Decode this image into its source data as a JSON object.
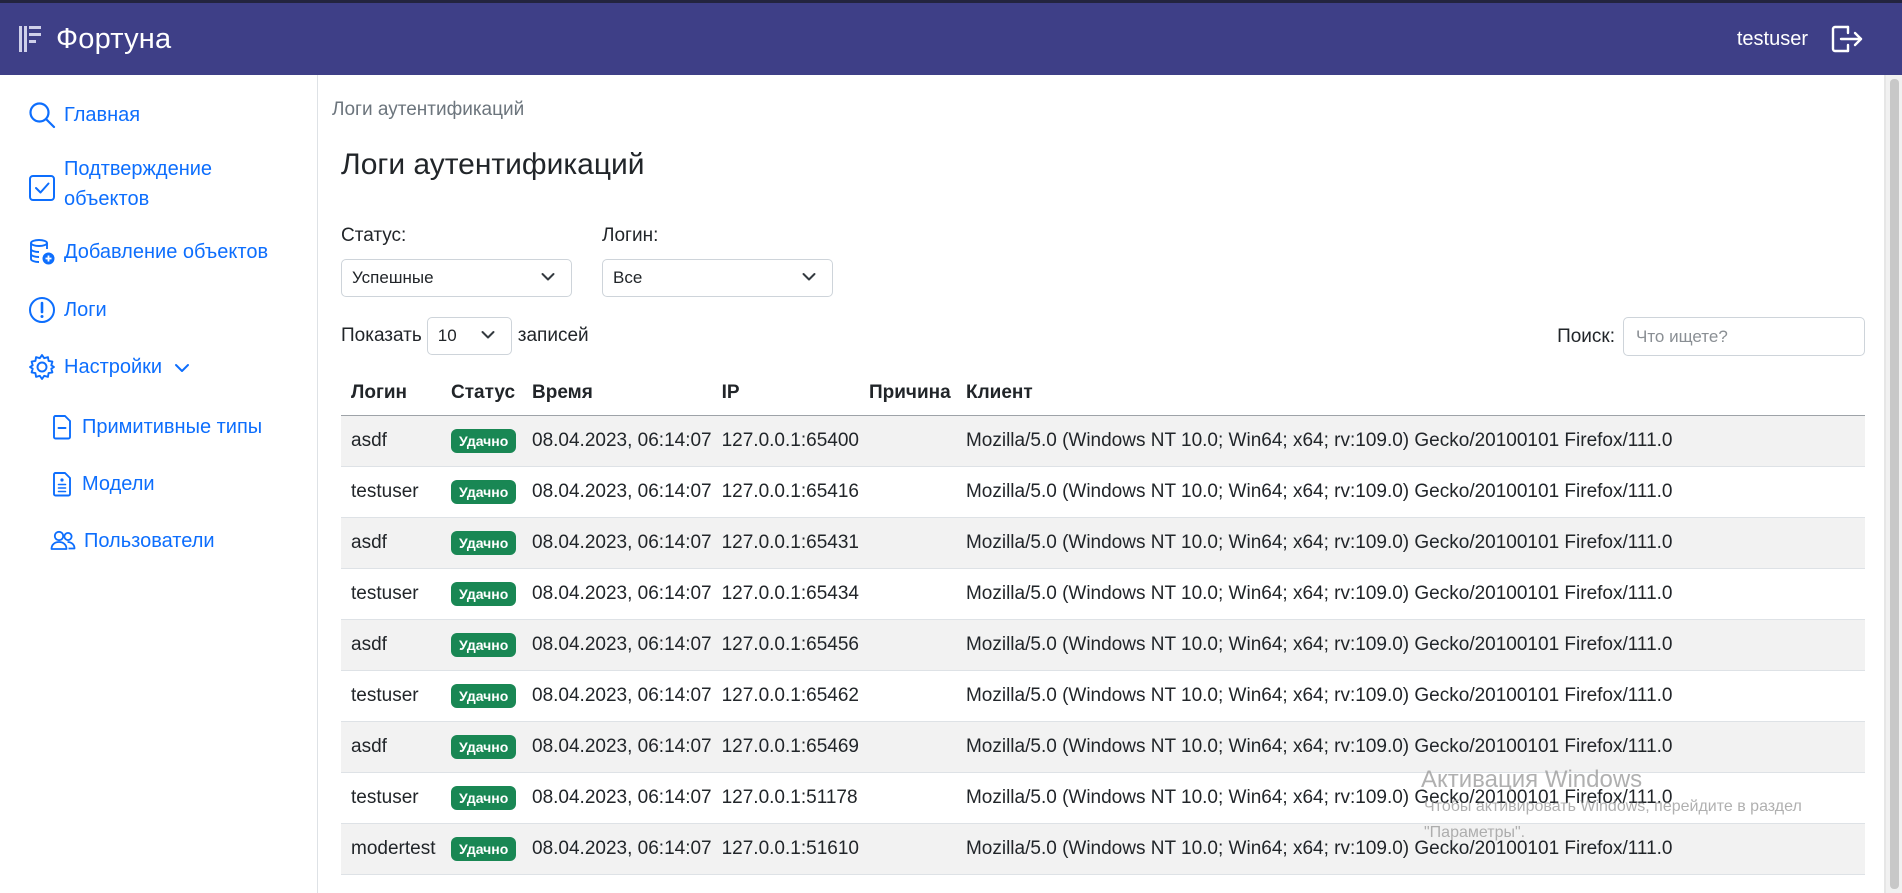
{
  "app": {
    "name": "Фортуна",
    "username": "testuser"
  },
  "sidebar": {
    "items": [
      {
        "label": "Главная",
        "icon": "search-icon"
      },
      {
        "label": "Подтверждение объектов",
        "icon": "check-square-icon"
      },
      {
        "label": "Добавление объектов",
        "icon": "database-add-icon"
      },
      {
        "label": "Логи",
        "icon": "exclamation-circle-icon"
      },
      {
        "label": "Настройки",
        "icon": "gear-icon"
      }
    ],
    "subitems": [
      {
        "label": "Примитивные типы",
        "icon": "file-minus-icon"
      },
      {
        "label": "Модели",
        "icon": "file-list-icon"
      },
      {
        "label": "Пользователи",
        "icon": "people-icon"
      }
    ]
  },
  "main": {
    "breadcrumb": "Логи аутентификаций",
    "title": "Логи аутентификаций",
    "filters": {
      "status_label": "Статус:",
      "status_value": "Успешные",
      "login_label": "Логин:",
      "login_value": "Все"
    },
    "length": {
      "before": "Показать",
      "value": "10",
      "after": "записей"
    },
    "search": {
      "label": "Поиск:",
      "placeholder": "Что ищете?"
    }
  },
  "table": {
    "columns": [
      "Логин",
      "Статус",
      "Время",
      "IP",
      "Причина",
      "Клиент"
    ],
    "rows": [
      {
        "login": "asdf",
        "status": "Удачно",
        "time": "08.04.2023, 06:14:07",
        "ip": "127.0.0.1:65400",
        "reason": "",
        "client": "Mozilla/5.0 (Windows NT 10.0; Win64; x64; rv:109.0) Gecko/20100101 Firefox/111.0"
      },
      {
        "login": "testuser",
        "status": "Удачно",
        "time": "08.04.2023, 06:14:07",
        "ip": "127.0.0.1:65416",
        "reason": "",
        "client": "Mozilla/5.0 (Windows NT 10.0; Win64; x64; rv:109.0) Gecko/20100101 Firefox/111.0"
      },
      {
        "login": "asdf",
        "status": "Удачно",
        "time": "08.04.2023, 06:14:07",
        "ip": "127.0.0.1:65431",
        "reason": "",
        "client": "Mozilla/5.0 (Windows NT 10.0; Win64; x64; rv:109.0) Gecko/20100101 Firefox/111.0"
      },
      {
        "login": "testuser",
        "status": "Удачно",
        "time": "08.04.2023, 06:14:07",
        "ip": "127.0.0.1:65434",
        "reason": "",
        "client": "Mozilla/5.0 (Windows NT 10.0; Win64; x64; rv:109.0) Gecko/20100101 Firefox/111.0"
      },
      {
        "login": "asdf",
        "status": "Удачно",
        "time": "08.04.2023, 06:14:07",
        "ip": "127.0.0.1:65456",
        "reason": "",
        "client": "Mozilla/5.0 (Windows NT 10.0; Win64; x64; rv:109.0) Gecko/20100101 Firefox/111.0"
      },
      {
        "login": "testuser",
        "status": "Удачно",
        "time": "08.04.2023, 06:14:07",
        "ip": "127.0.0.1:65462",
        "reason": "",
        "client": "Mozilla/5.0 (Windows NT 10.0; Win64; x64; rv:109.0) Gecko/20100101 Firefox/111.0"
      },
      {
        "login": "asdf",
        "status": "Удачно",
        "time": "08.04.2023, 06:14:07",
        "ip": "127.0.0.1:65469",
        "reason": "",
        "client": "Mozilla/5.0 (Windows NT 10.0; Win64; x64; rv:109.0) Gecko/20100101 Firefox/111.0"
      },
      {
        "login": "testuser",
        "status": "Удачно",
        "time": "08.04.2023, 06:14:07",
        "ip": "127.0.0.1:51178",
        "reason": "",
        "client": "Mozilla/5.0 (Windows NT 10.0; Win64; x64; rv:109.0) Gecko/20100101 Firefox/111.0"
      },
      {
        "login": "modertest",
        "status": "Удачно",
        "time": "08.04.2023, 06:14:07",
        "ip": "127.0.0.1:51610",
        "reason": "",
        "client": "Mozilla/5.0 (Windows NT 10.0; Win64; x64; rv:109.0) Gecko/20100101 Firefox/111.0"
      }
    ]
  },
  "watermark": {
    "title": "Активация Windows",
    "line1": "Чтобы активировать Windows, перейдите в раздел",
    "line2": "\"Параметры\"."
  },
  "colors": {
    "topbar": "#3e3f87",
    "link": "#0d6efd",
    "success_badge": "#198754",
    "stripe": "#f2f2f2"
  }
}
